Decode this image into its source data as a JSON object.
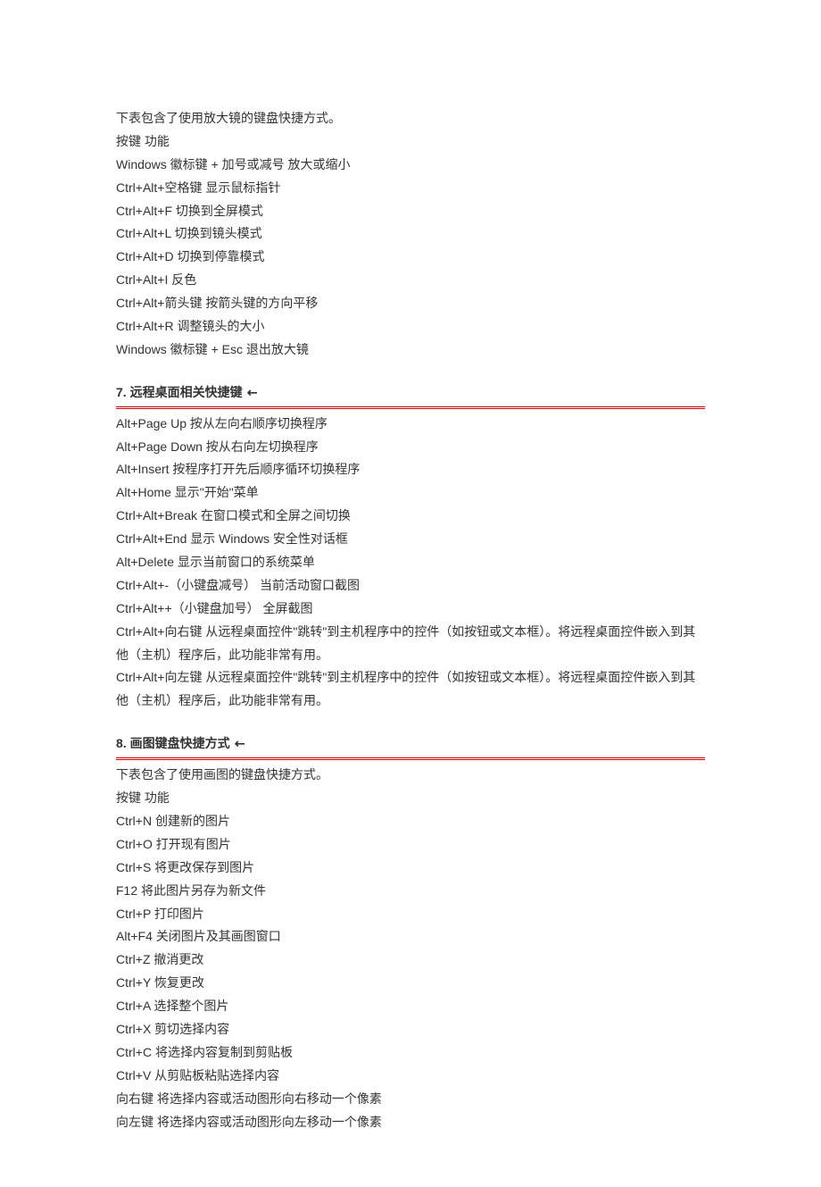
{
  "magnifier": {
    "intro": "下表包含了使用放大镜的键盘快捷方式。",
    "header": "按键 功能",
    "items": [
      "Windows 徽标键 + 加号或减号 放大或缩小",
      "Ctrl+Alt+空格键 显示鼠标指针",
      "Ctrl+Alt+F 切换到全屏模式",
      "Ctrl+Alt+L 切换到镜头模式",
      "Ctrl+Alt+D 切换到停靠模式",
      "Ctrl+Alt+I 反色",
      "Ctrl+Alt+箭头键 按箭头键的方向平移",
      "Ctrl+Alt+R 调整镜头的大小",
      "Windows 徽标键 + Esc 退出放大镜"
    ]
  },
  "section7": {
    "num": "7.",
    "title": "远程桌面相关快捷键",
    "arrow": "↖",
    "items": [
      "Alt+Page Up 按从左向右顺序切换程序",
      "Alt+Page Down 按从右向左切换程序",
      "Alt+Insert 按程序打开先后顺序循环切换程序",
      "Alt+Home 显示\"开始\"菜单",
      "Ctrl+Alt+Break 在窗口模式和全屏之间切换",
      "Ctrl+Alt+End 显示 Windows 安全性对话框",
      "Alt+Delete 显示当前窗口的系统菜单",
      "Ctrl+Alt+-（小键盘减号） 当前活动窗口截图",
      "Ctrl+Alt++（小键盘加号） 全屏截图",
      "Ctrl+Alt+向右键 从远程桌面控件\"跳转\"到主机程序中的控件（如按钮或文本框）。将远程桌面控件嵌入到其他（主机）程序后，此功能非常有用。",
      "Ctrl+Alt+向左键 从远程桌面控件\"跳转\"到主机程序中的控件（如按钮或文本框）。将远程桌面控件嵌入到其他（主机）程序后，此功能非常有用。"
    ]
  },
  "section8": {
    "num": "8.",
    "title": "画图键盘快捷方式",
    "arrow": "↖",
    "intro": "下表包含了使用画图的键盘快捷方式。",
    "header": "按键 功能",
    "items": [
      "Ctrl+N 创建新的图片",
      "Ctrl+O 打开现有图片",
      "Ctrl+S 将更改保存到图片",
      "F12 将此图片另存为新文件",
      "Ctrl+P 打印图片",
      "Alt+F4 关闭图片及其画图窗口",
      "Ctrl+Z 撤消更改",
      "Ctrl+Y 恢复更改",
      "Ctrl+A 选择整个图片",
      "Ctrl+X 剪切选择内容",
      "Ctrl+C 将选择内容复制到剪贴板",
      "Ctrl+V 从剪贴板粘贴选择内容",
      "向右键 将选择内容或活动图形向右移动一个像素",
      "向左键 将选择内容或活动图形向左移动一个像素"
    ]
  }
}
